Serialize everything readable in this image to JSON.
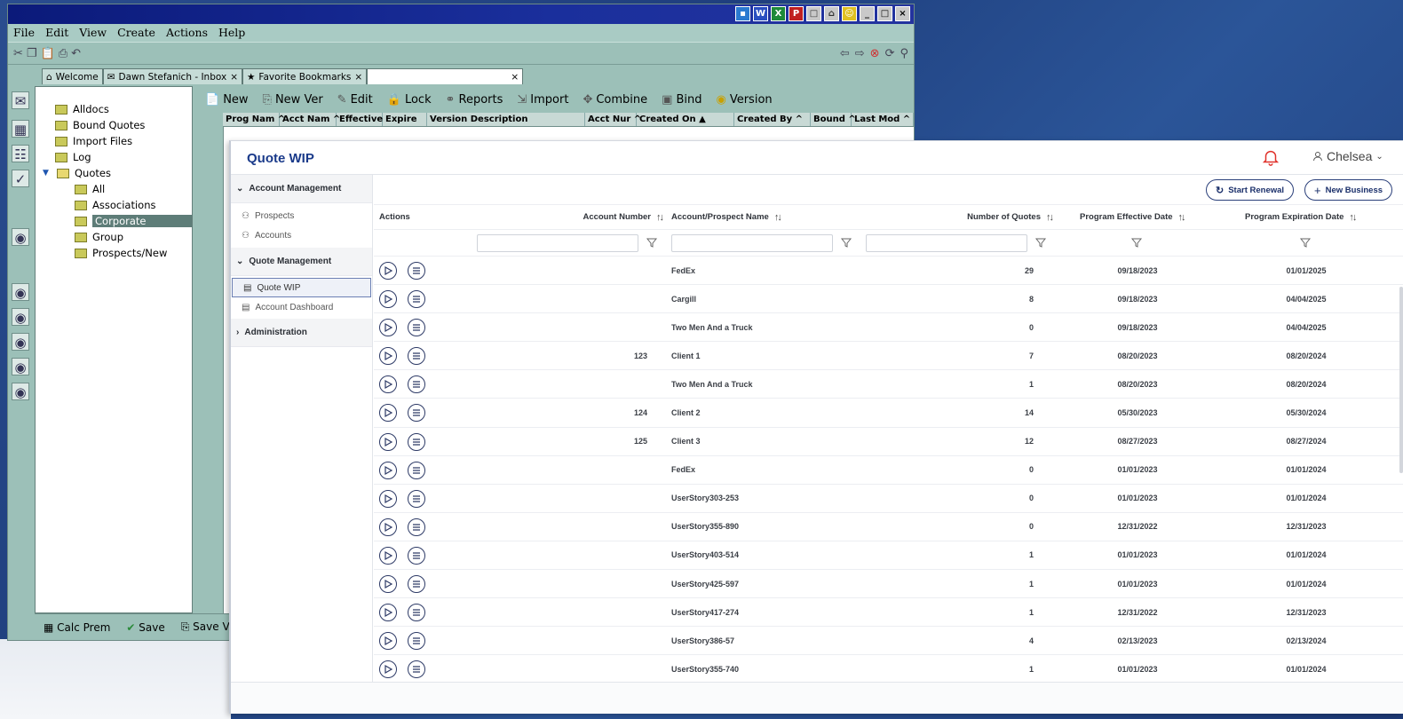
{
  "legacy": {
    "menu": [
      "File",
      "Edit",
      "View",
      "Create",
      "Actions",
      "Help"
    ],
    "tabs": [
      {
        "label": "Welcome",
        "icon": "home-icon"
      },
      {
        "label": "Dawn Stefanich - Inbox",
        "icon": "inbox-icon"
      },
      {
        "label": "Favorite Bookmarks",
        "icon": "bookmark-icon"
      }
    ],
    "tree": [
      "Alldocs",
      "Bound Quotes",
      "Import Files",
      "Log",
      "Quotes",
      "All",
      "Associations",
      "Corporate",
      "Group",
      "Prospects/New"
    ],
    "actions": [
      "New",
      "New Ver",
      "Edit",
      "Lock",
      "Reports",
      "Import",
      "Combine",
      "Bind",
      "Version"
    ],
    "columns": [
      "Prog Nam ^",
      "Acct Nam ^",
      "Effective",
      "Expire",
      "Version Description",
      "Acct Nur ^",
      "Created On ▲",
      "Created By ^",
      "Bound ^",
      "Last Mod ^"
    ],
    "status_buttons": [
      "Calc Prem",
      "Save",
      "Save V"
    ]
  },
  "app": {
    "title": "Quote WIP",
    "user": "Chelsea",
    "nav": {
      "account_group": "Account Management",
      "account_items": [
        "Prospects",
        "Accounts"
      ],
      "quote_group": "Quote Management",
      "quote_items": [
        "Quote WIP",
        "Account Dashboard"
      ],
      "admin_group": "Administration"
    },
    "buttons": {
      "start_renewal": "Start Renewal",
      "new_business": "New Business"
    },
    "columns": {
      "actions": "Actions",
      "account_number": "Account Number",
      "account_name": "Account/Prospect Name",
      "num_quotes": "Number of Quotes",
      "effective": "Program Effective Date",
      "expiration": "Program Expiration Date"
    },
    "rows": [
      {
        "acct": "",
        "name": "FedEx",
        "quotes": "29",
        "eff": "09/18/2023",
        "exp": "01/01/2025"
      },
      {
        "acct": "",
        "name": "Cargill",
        "quotes": "8",
        "eff": "09/18/2023",
        "exp": "04/04/2025"
      },
      {
        "acct": "",
        "name": "Two Men And a Truck",
        "quotes": "0",
        "eff": "09/18/2023",
        "exp": "04/04/2025"
      },
      {
        "acct": "123",
        "name": "Client 1",
        "quotes": "7",
        "eff": "08/20/2023",
        "exp": "08/20/2024"
      },
      {
        "acct": "",
        "name": "Two Men And a Truck",
        "quotes": "1",
        "eff": "08/20/2023",
        "exp": "08/20/2024"
      },
      {
        "acct": "124",
        "name": "Client 2",
        "quotes": "14",
        "eff": "05/30/2023",
        "exp": "05/30/2024"
      },
      {
        "acct": "125",
        "name": "Client 3",
        "quotes": "12",
        "eff": "08/27/2023",
        "exp": "08/27/2024"
      },
      {
        "acct": "",
        "name": "FedEx",
        "quotes": "0",
        "eff": "01/01/2023",
        "exp": "01/01/2024"
      },
      {
        "acct": "",
        "name": "UserStory303-253",
        "quotes": "0",
        "eff": "01/01/2023",
        "exp": "01/01/2024"
      },
      {
        "acct": "",
        "name": "UserStory355-890",
        "quotes": "0",
        "eff": "12/31/2022",
        "exp": "12/31/2023"
      },
      {
        "acct": "",
        "name": "UserStory403-514",
        "quotes": "1",
        "eff": "01/01/2023",
        "exp": "01/01/2024"
      },
      {
        "acct": "",
        "name": "UserStory425-597",
        "quotes": "1",
        "eff": "01/01/2023",
        "exp": "01/01/2024"
      },
      {
        "acct": "",
        "name": "UserStory417-274",
        "quotes": "1",
        "eff": "12/31/2022",
        "exp": "12/31/2023"
      },
      {
        "acct": "",
        "name": "UserStory386-57",
        "quotes": "4",
        "eff": "02/13/2023",
        "exp": "02/13/2024"
      },
      {
        "acct": "",
        "name": "UserStory355-740",
        "quotes": "1",
        "eff": "01/01/2023",
        "exp": "01/01/2024"
      }
    ],
    "colors": {
      "brand": "#1a3a8a",
      "alert": "#e0312a"
    }
  }
}
